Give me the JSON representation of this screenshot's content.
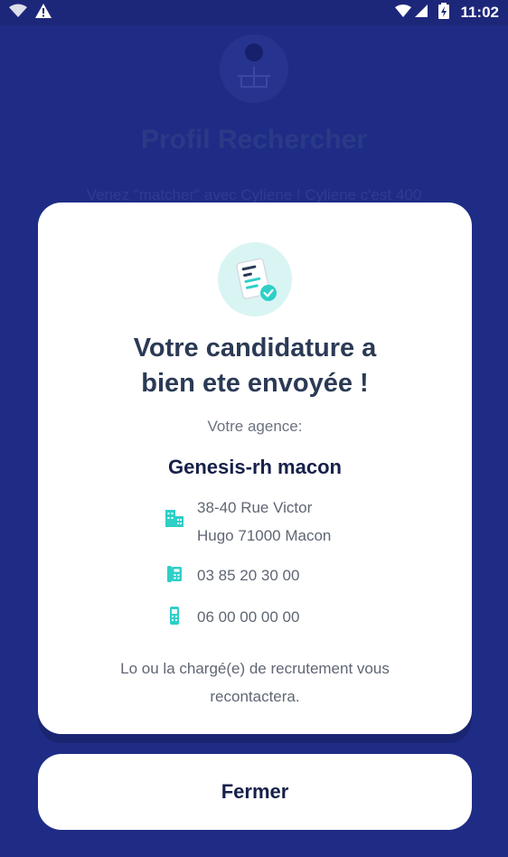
{
  "status_bar": {
    "time": "11:02",
    "icons": [
      "wifi-icon",
      "warning-icon",
      "signal-icon",
      "battery-icon"
    ]
  },
  "background": {
    "title": "Profil Rechercher",
    "subtitle": "Venez \"matcher\" avec Cyliene ! Cyliene c'est 400"
  },
  "modal": {
    "icon": "document-check-icon",
    "title_line1": "Votre candidature a",
    "title_line2": "bien ete envoyée !",
    "agency_label": "Votre agence:",
    "agency_name": "Genesis-rh macon",
    "address_line1": "38-40 Rue Victor",
    "address_line2": "Hugo 71000 Macon",
    "phone": "03 85 20 30 00",
    "mobile": "06 00 00 00 00",
    "footer_line1": "Lo ou la chargé(e) de recrutement vous",
    "footer_line2": "recontactera."
  },
  "actions": {
    "close_label": "Fermer"
  },
  "colors": {
    "backdrop": "#1f2c86",
    "accent": "#2ecfc7",
    "title_text": "#2b3a55",
    "agency_text": "#16204a"
  }
}
